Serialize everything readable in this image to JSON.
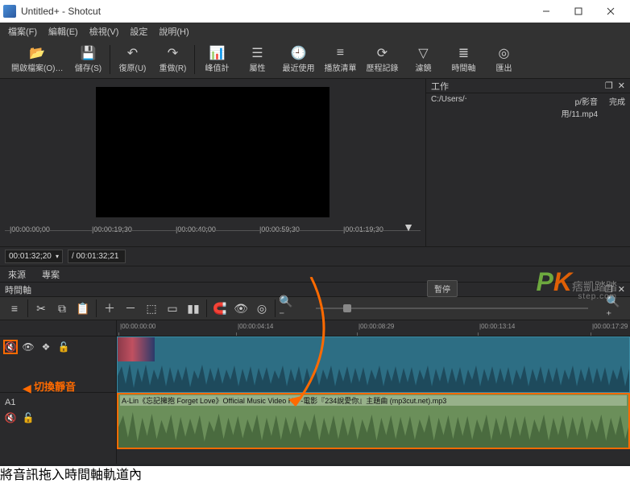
{
  "titlebar": {
    "title": "Untitled+ - Shotcut"
  },
  "menubar": [
    "檔案(F)",
    "編輯(E)",
    "檢視(V)",
    "設定",
    "說明(H)"
  ],
  "toolbar": [
    {
      "icon": "folder-open",
      "label": "開啟檔案(O)…"
    },
    {
      "icon": "save",
      "label": "儲存(S)"
    },
    {
      "sep": true
    },
    {
      "icon": "undo",
      "label": "復原(U)"
    },
    {
      "icon": "redo",
      "label": "重做(R)"
    },
    {
      "sep": true
    },
    {
      "icon": "meters",
      "label": "峰值計"
    },
    {
      "icon": "props",
      "label": "屬性"
    },
    {
      "icon": "recent",
      "label": "最近使用"
    },
    {
      "icon": "playlist",
      "label": "播放清單"
    },
    {
      "icon": "history",
      "label": "歷程記錄"
    },
    {
      "icon": "filters",
      "label": "濾鏡"
    },
    {
      "icon": "timeline",
      "label": "時間軸"
    },
    {
      "icon": "export",
      "label": "匯出"
    }
  ],
  "preview_ruler": [
    "|00:00:00;00",
    "|00:00:19;30",
    "|00:00:40;00",
    "|00:00:59;30",
    "|00:01:19;30"
  ],
  "jobs": {
    "title": "工作",
    "rows": [
      {
        "path": "C:/Users/‧",
        "name": "p/影音用/11.mp4",
        "status": "完成"
      }
    ]
  },
  "transport": {
    "tc1": "00:01:32;20",
    "tc2": "/ 00:01:32;21"
  },
  "pause_label": "暫停",
  "sourcetabs": [
    "來源",
    "專案"
  ],
  "timeline_title": "時間軸",
  "tl_ruler": [
    "|00:00:00:00",
    "|00:00:04:14",
    "|00:00:08:29",
    "|00:00:13:14",
    "|00:00:17:29"
  ],
  "audio_clip_label": "A-Lin《忘記擁抱 Forget Love》Official Music Video HD -電影『234說愛你』主題曲 (mp3cut.net).mp3",
  "track_a_label": "A1",
  "annotation_main": "將音訊拖入時間軸軌道內",
  "annotation_mute": "切換靜音",
  "watermark": {
    "p": "P",
    "k": "K",
    "sub": "痞凱踏踏",
    "step": "step.com"
  }
}
